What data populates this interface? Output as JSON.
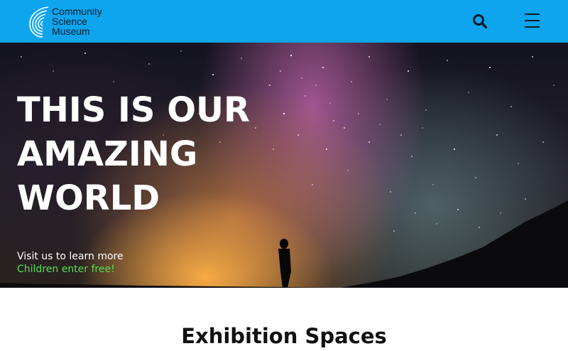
{
  "header": {
    "brand_line1": "Community",
    "brand_line2": "Science",
    "brand_line3": "Museum",
    "icons": {
      "search": "search-icon",
      "menu": "hamburger-menu-icon",
      "logo": "spiral-logo-icon"
    },
    "background_color": "#0ea5ee"
  },
  "hero": {
    "title_line1": "THIS IS OUR",
    "title_line2": "AMAZING",
    "title_line3": "WORLD",
    "visit_text": "Visit us to learn more",
    "free_text": "Children enter free!",
    "free_text_color": "#53e04a"
  },
  "section": {
    "title": "Exhibition Spaces"
  }
}
